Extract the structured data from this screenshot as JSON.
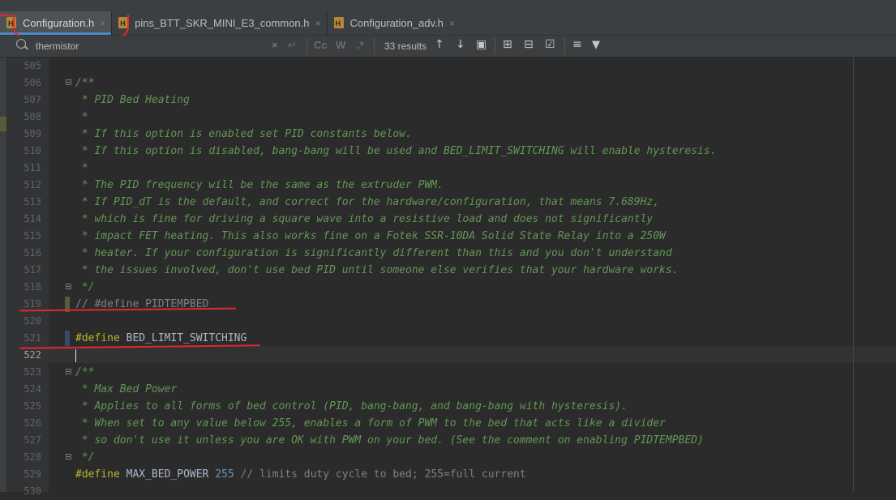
{
  "tabs": [
    {
      "name": "Configuration.h",
      "active": true
    },
    {
      "name": "pins_BTT_SKR_MINI_E3_common.h",
      "active": false
    },
    {
      "name": "Configuration_adv.h",
      "active": false
    }
  ],
  "search": {
    "query": "thermistor",
    "results": "33 results",
    "match_case": "Cc",
    "words": "W",
    "regex": ".*"
  },
  "icons": {
    "tab_close": "×",
    "clear": "×",
    "newline": "↵",
    "prev": "↑",
    "next": "↓",
    "select_all": "▣",
    "add_cursor": "⊞",
    "remove_cursor": "⊟",
    "select_all_occ": "☑",
    "options": "≡",
    "filter": "▼"
  },
  "colors": {
    "comment": "#629755",
    "keyword": "#bbb529",
    "number": "#6897bb",
    "text": "#a9b7c6",
    "disabled": "#808080"
  },
  "lines": [
    {
      "n": "505",
      "text": ""
    },
    {
      "n": "506",
      "text": "/**",
      "fold": true
    },
    {
      "n": "507",
      "text": " * PID Bed Heating"
    },
    {
      "n": "508",
      "text": " *"
    },
    {
      "n": "509",
      "text": " * If this option is enabled set PID constants below."
    },
    {
      "n": "510",
      "text": " * If this option is disabled, bang-bang will be used and BED_LIMIT_SWITCHING will enable hysteresis."
    },
    {
      "n": "511",
      "text": " *"
    },
    {
      "n": "512",
      "text": " * The PID frequency will be the same as the extruder PWM."
    },
    {
      "n": "513",
      "text": " * If PID_dT is the default, and correct for the hardware/configuration, that means 7.689Hz,"
    },
    {
      "n": "514",
      "text": " * which is fine for driving a square wave into a resistive load and does not significantly"
    },
    {
      "n": "515",
      "text": " * impact FET heating. This also works fine on a Fotek SSR-10DA Solid State Relay into a 250W"
    },
    {
      "n": "516",
      "text": " * heater. If your configuration is significantly different than this and you don't understand"
    },
    {
      "n": "517",
      "text": " * the issues involved, don't use bed PID until someone else verifies that your hardware works."
    },
    {
      "n": "518",
      "text": " */",
      "fold": true
    },
    {
      "n": "519",
      "text": "// #define PIDTEMPBED"
    },
    {
      "n": "520",
      "text": ""
    },
    {
      "n": "521",
      "define": "#define",
      "rest": " BED_LIMIT_SWITCHING"
    },
    {
      "n": "522",
      "text": ""
    },
    {
      "n": "523",
      "text": "/**",
      "fold": true
    },
    {
      "n": "524",
      "text": " * Max Bed Power"
    },
    {
      "n": "525",
      "text": " * Applies to all forms of bed control (PID, bang-bang, and bang-bang with hysteresis)."
    },
    {
      "n": "526",
      "text": " * When set to any value below 255, enables a form of PWM to the bed that acts like a divider"
    },
    {
      "n": "527",
      "text": " * so don't use it unless you are OK with PWM on your bed. (See the comment on enabling PIDTEMPBED)"
    },
    {
      "n": "528",
      "text": " */",
      "fold": true
    },
    {
      "n": "529",
      "define": "#define",
      "rest": " MAX_BED_POWER ",
      "num": "255",
      "comment": " // limits duty cycle to bed; 255=full current"
    },
    {
      "n": "530",
      "text": ""
    }
  ]
}
